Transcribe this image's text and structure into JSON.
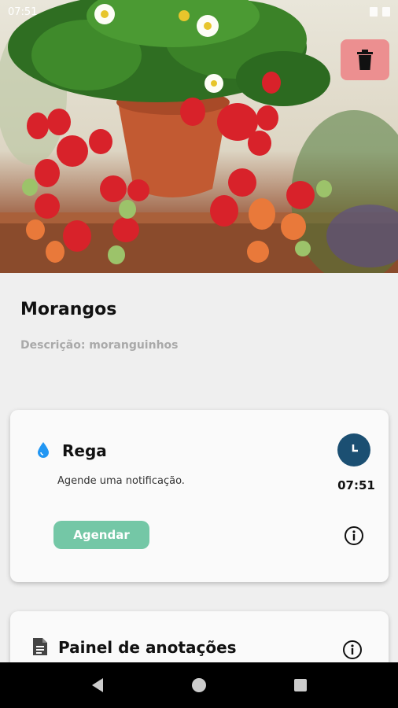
{
  "status_bar": {
    "time": "07:51"
  },
  "plant": {
    "name": "Morangos",
    "description": "Descrição: moranguinhos"
  },
  "icons": {
    "delete": "trash-icon",
    "water": "water-drop-icon",
    "clock": "clock-icon",
    "info": "info-icon",
    "notes": "document-icon",
    "nav_back": "back-triangle-icon",
    "nav_home": "home-circle-icon",
    "nav_recents": "recents-square-icon"
  },
  "rega_card": {
    "title": "Rega",
    "subtitle": "Agende uma notificação.",
    "time": "07:51",
    "schedule_label": "Agendar"
  },
  "notes_card": {
    "title": "Painel de anotações"
  },
  "colors": {
    "delete_button": "#ec8f90",
    "clock_button": "#1b4f72",
    "schedule_button": "#74c7a6",
    "water_drop": "#2196f3",
    "background": "#efefef"
  }
}
